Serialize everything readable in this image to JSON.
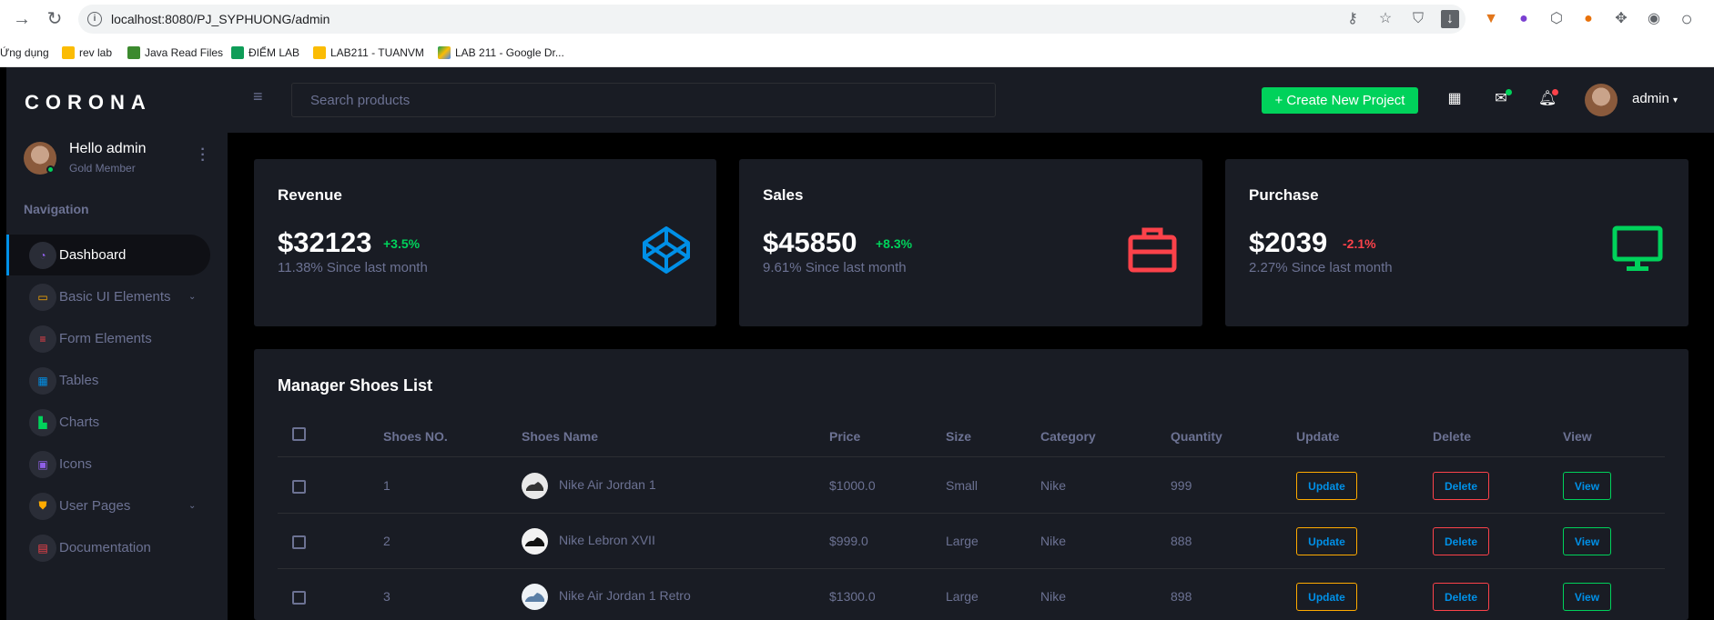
{
  "browser": {
    "url": "localhost:8080/PJ_SYPHUONG/admin",
    "bookmarks": [
      {
        "label": "Ứng dụng"
      },
      {
        "label": "rev lab"
      },
      {
        "label": "Java Read Files"
      },
      {
        "label": "ĐIỂM LAB"
      },
      {
        "label": "LAB211 - TUANVM"
      },
      {
        "label": "LAB 211 - Google Dr..."
      }
    ]
  },
  "sidebar": {
    "brand": "CORONA",
    "profile": {
      "name": "Hello admin",
      "role": "Gold Member"
    },
    "nav_title": "Navigation",
    "items": [
      {
        "label": "Dashboard",
        "icon": "speedometer-icon",
        "color": "#8f5fe8"
      },
      {
        "label": "Basic UI Elements",
        "icon": "laptop-icon",
        "color": "#ffab00"
      },
      {
        "label": "Form Elements",
        "icon": "playlist-icon",
        "color": "#fc424a"
      },
      {
        "label": "Tables",
        "icon": "table-icon",
        "color": "#0090e7"
      },
      {
        "label": "Charts",
        "icon": "chart-bar-icon",
        "color": "#00d25b"
      },
      {
        "label": "Icons",
        "icon": "contacts-icon",
        "color": "#8f5fe8"
      },
      {
        "label": "User Pages",
        "icon": "security-icon",
        "color": "#ffab00"
      },
      {
        "label": "Documentation",
        "icon": "file-document-icon",
        "color": "#fc424a"
      }
    ]
  },
  "topbar": {
    "search_placeholder": "Search products",
    "create_label": "+ Create New Project",
    "user_name": "admin"
  },
  "cards": [
    {
      "title": "Revenue",
      "amount": "$32123",
      "delta": "+3.5%",
      "delta_color": "#00d25b",
      "sub": "11.38% Since last month",
      "icon": "codepen-icon",
      "icon_color": "#0090e7"
    },
    {
      "title": "Sales",
      "amount": "$45850",
      "delta": "+8.3%",
      "delta_color": "#00d25b",
      "sub": "9.61% Since last month",
      "icon": "briefcase-icon",
      "icon_color": "#fc424a"
    },
    {
      "title": "Purchase",
      "amount": "$2039",
      "delta": "-2.1%",
      "delta_color": "#fc424a",
      "sub": "2.27% Since last month",
      "icon": "monitor-icon",
      "icon_color": "#00d25b"
    }
  ],
  "table": {
    "title": "Manager Shoes List",
    "headers": [
      "Shoes NO.",
      "Shoes Name",
      "Price",
      "Size",
      "Category",
      "Quantity",
      "Update",
      "Delete",
      "View"
    ],
    "rows": [
      {
        "no": "1",
        "name": "Nike Air Jordan 1",
        "price": "$1000.0",
        "size": "Small",
        "category": "Nike",
        "quantity": "999",
        "update": "Update",
        "delete": "Delete",
        "view": "View"
      },
      {
        "no": "2",
        "name": "Nike Lebron XVII",
        "price": "$999.0",
        "size": "Large",
        "category": "Nike",
        "quantity": "888",
        "update": "Update",
        "delete": "Delete",
        "view": "View"
      },
      {
        "no": "3",
        "name": "Nike Air Jordan 1 Retro",
        "price": "$1300.0",
        "size": "Large",
        "category": "Nike",
        "quantity": "898",
        "update": "Update",
        "delete": "Delete",
        "view": "View"
      }
    ]
  }
}
